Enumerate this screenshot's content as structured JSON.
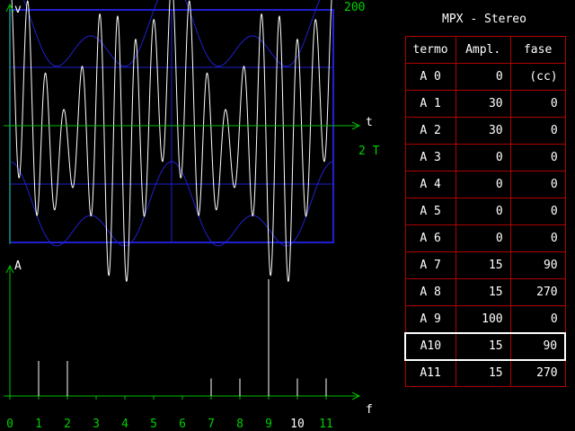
{
  "oscilloscope": {
    "y_axis_label": "v",
    "x_axis_label": "t",
    "scale_label": "200",
    "period_label": "2 T"
  },
  "spectrum": {
    "y_axis_label": "A",
    "x_axis_label": "f",
    "tick_labels": [
      "0",
      "1",
      "2",
      "3",
      "4",
      "5",
      "6",
      "7",
      "8",
      "9",
      "10",
      "11"
    ],
    "highlighted_tick": "10"
  },
  "table": {
    "title": "MPX - Stereo",
    "headers": {
      "term": "termo",
      "amplitude": "Ampl.",
      "phase": "fase"
    },
    "rows": [
      {
        "term": "A 0",
        "amplitude": "0",
        "phase": "(cc)"
      },
      {
        "term": "A 1",
        "amplitude": "30",
        "phase": "0"
      },
      {
        "term": "A 2",
        "amplitude": "30",
        "phase": "0"
      },
      {
        "term": "A 3",
        "amplitude": "0",
        "phase": "0"
      },
      {
        "term": "A 4",
        "amplitude": "0",
        "phase": "0"
      },
      {
        "term": "A 5",
        "amplitude": "0",
        "phase": "0"
      },
      {
        "term": "A 6",
        "amplitude": "0",
        "phase": "0"
      },
      {
        "term": "A 7",
        "amplitude": "15",
        "phase": "90"
      },
      {
        "term": "A 8",
        "amplitude": "15",
        "phase": "270"
      },
      {
        "term": "A 9",
        "amplitude": "100",
        "phase": "0"
      },
      {
        "term": "A10",
        "amplitude": "15",
        "phase": "90"
      },
      {
        "term": "A11",
        "amplitude": "15",
        "phase": "270"
      }
    ],
    "selected_row": 10
  },
  "colors": {
    "axis": "#00c000",
    "frame": "#2020d0",
    "signal": "#ffffff",
    "envelope": "#2020d0",
    "label_green": "#00d000",
    "table_border": "#b00000"
  }
}
